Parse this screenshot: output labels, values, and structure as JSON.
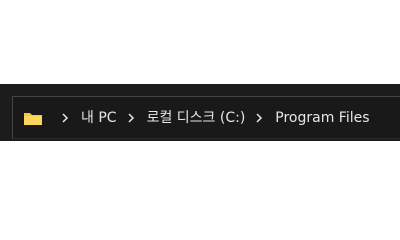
{
  "breadcrumb": {
    "root_icon": "folder-icon",
    "separator_icon": "chevron-right-icon",
    "items": [
      {
        "label": "내 PC"
      },
      {
        "label": "로컬 디스크 (C:)"
      },
      {
        "label": "Program Files"
      }
    ]
  },
  "colors": {
    "bar_background": "#191919",
    "window_background": "#1c1c1c",
    "text": "#e6e6e6",
    "folder_yellow": "#f6c544"
  }
}
